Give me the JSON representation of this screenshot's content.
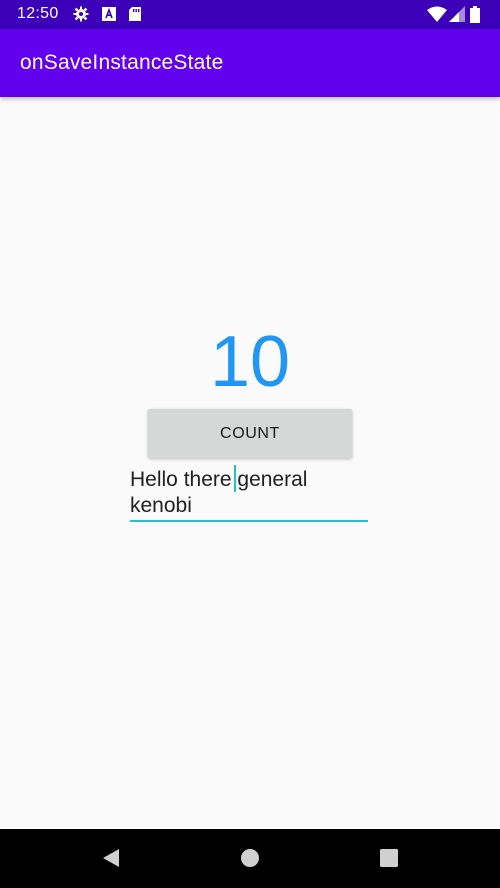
{
  "status_bar": {
    "time": "12:50",
    "icons": [
      "gear-icon",
      "a-icon",
      "sd-card-icon",
      "wifi-icon",
      "signal-icon",
      "battery-icon"
    ]
  },
  "app_bar": {
    "title": "onSaveInstanceState"
  },
  "main": {
    "counter_value": "10",
    "count_button_label": "COUNT",
    "edit_text_line1": "Hello there general",
    "edit_text_line2": "kenobi"
  },
  "nav_bar": {
    "buttons": [
      "back-icon",
      "home-icon",
      "recents-icon"
    ]
  },
  "colors": {
    "status_bar": "#3b00b8",
    "app_bar": "#6200ee",
    "counter": "#2196f3",
    "accent": "#20c4c4",
    "button_bg": "#d6d7d7",
    "background": "#fafafa"
  }
}
